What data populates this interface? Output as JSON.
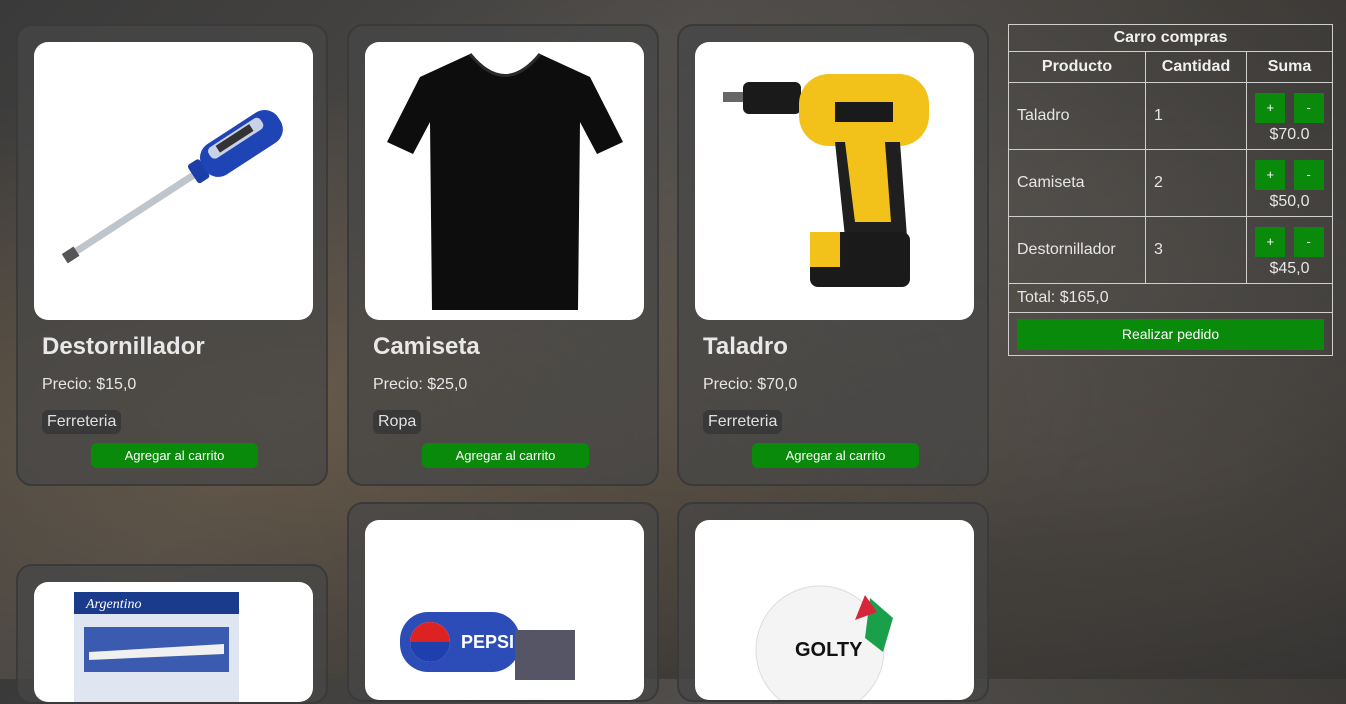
{
  "products": [
    {
      "name": "Destornillador",
      "price": "Precio: $15,0",
      "category": "Ferreteria",
      "button": "Agregar al carrito"
    },
    {
      "name": "Camiseta",
      "price": "Precio: $25,0",
      "category": "Ropa",
      "button": "Agregar al carrito"
    },
    {
      "name": "Taladro",
      "price": "Precio: $70,0",
      "category": "Ferreteria",
      "button": "Agregar al carrito"
    }
  ],
  "partial_products": [
    {
      "image": "toy-airplane-box-image",
      "box_text": "Argentino"
    },
    {
      "image": "pepsi-truck-image",
      "box_text": "PEPSI"
    },
    {
      "image": "soccer-ball-image",
      "box_text": "GOLTY"
    }
  ],
  "cart": {
    "title": "Carro compras",
    "headers": [
      "Producto",
      "Cantidad",
      "Suma"
    ],
    "items": [
      {
        "name": "Taladro",
        "qty": "1",
        "sum": "$70.0"
      },
      {
        "name": "Camiseta",
        "qty": "2",
        "sum": "$50,0"
      },
      {
        "name": "Destornillador",
        "qty": "3",
        "sum": "$45,0"
      }
    ],
    "plus": "+",
    "minus": "-",
    "total": "Total: $165,0",
    "order_button": "Realizar pedido"
  },
  "colors": {
    "accent_green": "#0a8a0a",
    "card_bg": "#464646"
  }
}
